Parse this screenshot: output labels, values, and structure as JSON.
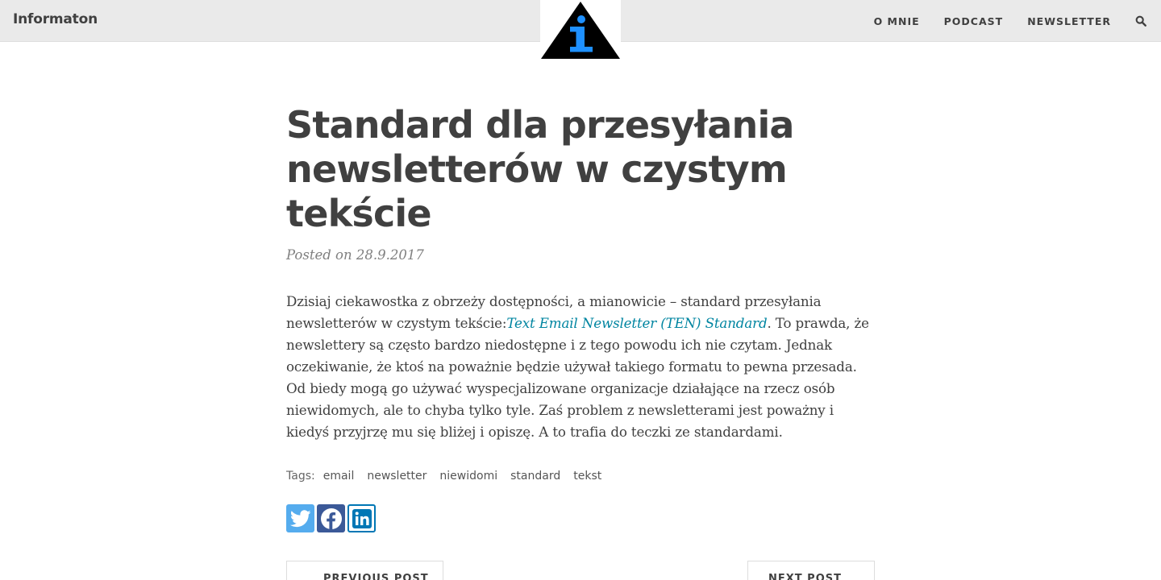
{
  "navbar": {
    "brand": "Informaton",
    "links": [
      "O MNIE",
      "PODCAST",
      "NEWSLETTER"
    ]
  },
  "post": {
    "title": "Standard dla przesyłania newsletterów w czystym tekście",
    "meta": "Posted on 28.9.2017",
    "body_part1": "Dzisiaj ciekawostka z obrzeży dostępności, a mianowicie – standard przesyłania newsletterów w czystym tekście:",
    "body_link": "Text Email Newsletter (TEN) Standard",
    "body_part2": ". To prawda, że newslettery są często bardzo niedostępne i z tego powodu ich nie czytam. Jednak oczekiwanie, że ktoś na poważnie będzie używał takiego formatu to pewna przesada. Od biedy mogą go używać wyspecjalizowane organizacje działające na rzecz osób niewidomych, ale to chyba tylko tyle. Zaś problem z newsletterami jest poważny i kiedyś przyjrzę mu się bliżej i opiszę. A to trafia do teczki ze standardami.",
    "tags_label": "Tags:",
    "tags": [
      "email",
      "newsletter",
      "niewidomi",
      "standard",
      "tekst"
    ]
  },
  "share": [
    "twitter-icon",
    "facebook-icon",
    "linkedin-icon"
  ],
  "pager": {
    "prev": "PREVIOUS POST",
    "next": "NEXT POST"
  },
  "colors": {
    "navbar_bg": "#eaeaea",
    "text": "#404040",
    "link": "#0085a1",
    "logo_blue": "#1e90ff",
    "twitter": "#55acee",
    "facebook": "#3b5998",
    "linkedin": "#0077b5"
  }
}
